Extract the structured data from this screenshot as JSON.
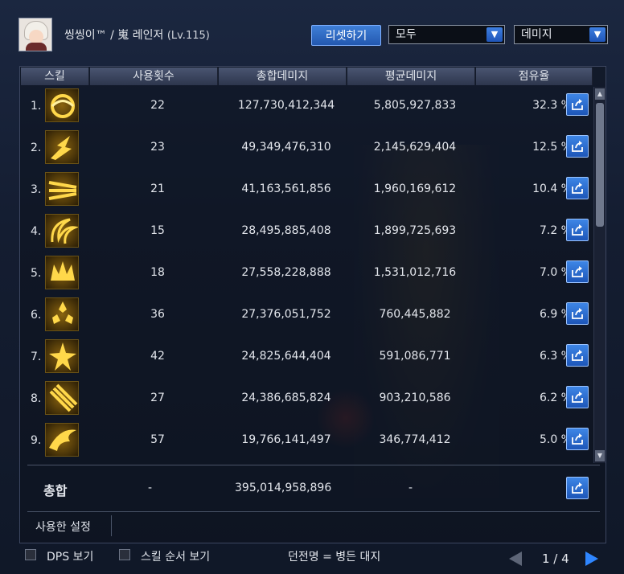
{
  "header": {
    "player_name": "씽씽이™ / 嵬 레인저",
    "level": "(Lv.115)",
    "reset_label": "리셋하기",
    "filter_value": "모두",
    "metric_value": "데미지"
  },
  "table": {
    "columns": [
      "스킬",
      "사용횟수",
      "총합데미지",
      "평균데미지",
      "점유율"
    ],
    "rows": [
      {
        "rank": "1.",
        "icon": "skill-icon-swirl",
        "count": "22",
        "total": "127,730,412,344",
        "avg": "5,805,927,833",
        "share": "32.3 %"
      },
      {
        "rank": "2.",
        "icon": "skill-icon-burst",
        "count": "23",
        "total": "49,349,476,310",
        "avg": "2,145,629,404",
        "share": "12.5 %"
      },
      {
        "rank": "3.",
        "icon": "skill-icon-arrows",
        "count": "21",
        "total": "41,163,561,856",
        "avg": "1,960,169,612",
        "share": "10.4 %"
      },
      {
        "rank": "4.",
        "icon": "skill-icon-spiral",
        "count": "15",
        "total": "28,495,885,408",
        "avg": "1,899,725,693",
        "share": "7.2 %"
      },
      {
        "rank": "5.",
        "icon": "skill-icon-crown",
        "count": "18",
        "total": "27,558,228,888",
        "avg": "1,531,012,716",
        "share": "7.0 %"
      },
      {
        "rank": "6.",
        "icon": "skill-icon-shuriken",
        "count": "36",
        "total": "27,376,051,752",
        "avg": "760,445,882",
        "share": "6.9 %"
      },
      {
        "rank": "7.",
        "icon": "skill-icon-star",
        "count": "42",
        "total": "24,825,644,404",
        "avg": "591,086,771",
        "share": "6.3 %"
      },
      {
        "rank": "8.",
        "icon": "skill-icon-hammer",
        "count": "27",
        "total": "24,386,685,824",
        "avg": "903,210,586",
        "share": "6.2 %"
      },
      {
        "rank": "9.",
        "icon": "skill-icon-wing",
        "count": "57",
        "total": "19,766,141,497",
        "avg": "346,774,412",
        "share": "5.0 %"
      }
    ],
    "summary": {
      "label": "총합",
      "count": "-",
      "total": "395,014,958,896",
      "avg": "-"
    },
    "settings_label": "사용한 설정"
  },
  "footer": {
    "dps_label": "DPS 보기",
    "order_label": "스킬 순서 보기",
    "dungeon_text": "던전명 = 병든 대지",
    "page": "1 / 4"
  },
  "colors": {
    "accent": "#2f86ff",
    "gold": "#f0c030",
    "panel": "#141d31"
  }
}
